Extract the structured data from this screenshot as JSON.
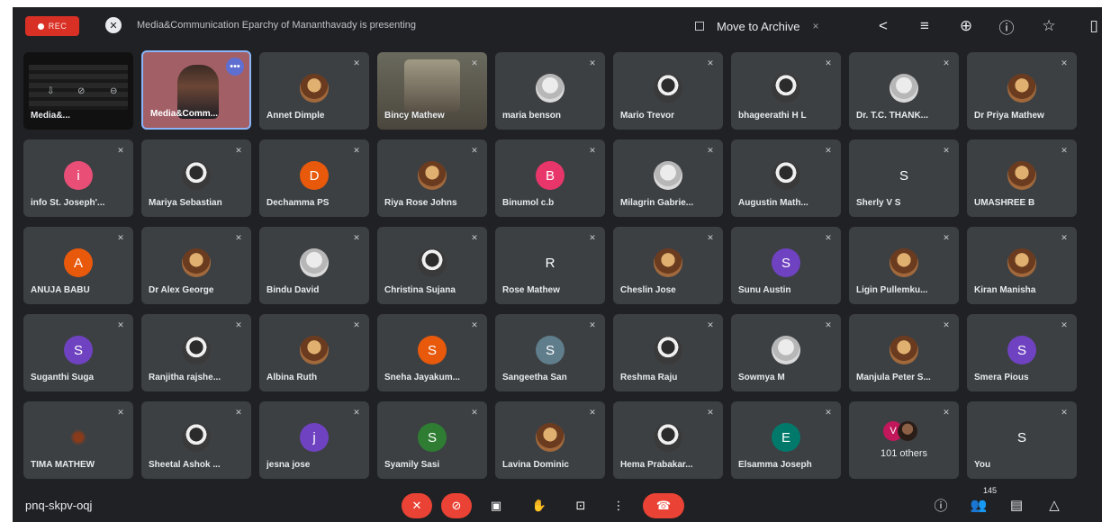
{
  "topbar": {
    "rec_label": "REC",
    "presenting_text": "Media&Communication Eparchy of Mananthavady is presenting",
    "archive_label": "Move to Archive",
    "archive_close": "×"
  },
  "presenter_tile": {
    "label": "Media&..."
  },
  "self_tile": {
    "label": "Media&Comm...",
    "more_label": "•••"
  },
  "tiles": [
    {
      "name": "Annet Dimple",
      "type": "photo",
      "variant": "warm"
    },
    {
      "name": "Bincy Mathew",
      "type": "video"
    },
    {
      "name": "maria benson",
      "type": "photo",
      "variant": "light"
    },
    {
      "name": "Mario Trevor",
      "type": "photo",
      "variant": "dark"
    },
    {
      "name": "bhageerathi H L",
      "type": "photo",
      "variant": "dark"
    },
    {
      "name": "Dr. T.C. THANK...",
      "type": "photo",
      "variant": "light"
    },
    {
      "name": "Dr Priya Mathew",
      "type": "photo",
      "variant": "warm"
    },
    {
      "name": "info St. Joseph'...",
      "type": "letter",
      "letter": "i",
      "color": "#e94e77"
    },
    {
      "name": "Mariya Sebastian",
      "type": "photo",
      "variant": "dark"
    },
    {
      "name": "Dechamma PS",
      "type": "letter",
      "letter": "D",
      "color": "#e8590c"
    },
    {
      "name": "Riya Rose Johns",
      "type": "photo",
      "variant": "warm"
    },
    {
      "name": "Binumol c.b",
      "type": "letter",
      "letter": "B",
      "color": "#e8366b"
    },
    {
      "name": "Milagrin Gabrie...",
      "type": "photo",
      "variant": "light"
    },
    {
      "name": "Augustin Math...",
      "type": "photo",
      "variant": "dark"
    },
    {
      "name": "Sherly V S",
      "type": "letter",
      "letter": "S",
      "color": "#3c4043"
    },
    {
      "name": "UMASHREE B",
      "type": "photo",
      "variant": "warm"
    },
    {
      "name": "ANUJA BABU",
      "type": "letter",
      "letter": "A",
      "color": "#e8590c"
    },
    {
      "name": "Dr Alex George",
      "type": "photo",
      "variant": "warm"
    },
    {
      "name": "Bindu David",
      "type": "photo",
      "variant": "light"
    },
    {
      "name": "Christina Sujana",
      "type": "photo",
      "variant": "dark"
    },
    {
      "name": "Rose Mathew",
      "type": "letter",
      "letter": "R",
      "color": "#3c4043"
    },
    {
      "name": "Cheslin Jose",
      "type": "photo",
      "variant": "warm"
    },
    {
      "name": "Sunu Austin",
      "type": "letter",
      "letter": "S",
      "color": "#6f42c1"
    },
    {
      "name": "Ligin Pullemku...",
      "type": "photo",
      "variant": "warm"
    },
    {
      "name": "Kiran Manisha",
      "type": "photo",
      "variant": "warm"
    },
    {
      "name": "Suganthi Suga",
      "type": "letter",
      "letter": "S",
      "color": "#6f42c1"
    },
    {
      "name": "Ranjitha rajshe...",
      "type": "photo",
      "variant": "dark"
    },
    {
      "name": "Albina Ruth",
      "type": "photo",
      "variant": "warm"
    },
    {
      "name": "Sneha Jayakum...",
      "type": "letter",
      "letter": "S",
      "color": "#e8590c"
    },
    {
      "name": "Sangeetha San",
      "type": "letter",
      "letter": "S",
      "color": "#607d8b"
    },
    {
      "name": "Reshma Raju",
      "type": "photo",
      "variant": "dark"
    },
    {
      "name": "Sowmya M",
      "type": "photo",
      "variant": "light"
    },
    {
      "name": "Manjula Peter S...",
      "type": "photo",
      "variant": "warm"
    },
    {
      "name": "Smera Pious",
      "type": "letter",
      "letter": "S",
      "color": "#6f42c1"
    },
    {
      "name": "TIMA MATHEW",
      "type": "dim"
    },
    {
      "name": "Sheetal Ashok ...",
      "type": "photo",
      "variant": "dark"
    },
    {
      "name": "jesna jose",
      "type": "letter",
      "letter": "j",
      "color": "#6f42c1"
    },
    {
      "name": "Syamily Sasi",
      "type": "letter",
      "letter": "S",
      "color": "#2e7d32"
    },
    {
      "name": "Lavina Dominic",
      "type": "photo",
      "variant": "warm"
    },
    {
      "name": "Hema Prabakar...",
      "type": "photo",
      "variant": "dark"
    },
    {
      "name": "Elsamma Joseph",
      "type": "letter",
      "letter": "E",
      "color": "#00796b"
    },
    {
      "name": "101 others",
      "type": "others",
      "letter": "V"
    },
    {
      "name": "You",
      "type": "letter",
      "letter": "S",
      "color": "#3c4043"
    }
  ],
  "bottombar": {
    "meeting_code": "pnq-skpv-oqj",
    "participants_count": "145"
  }
}
